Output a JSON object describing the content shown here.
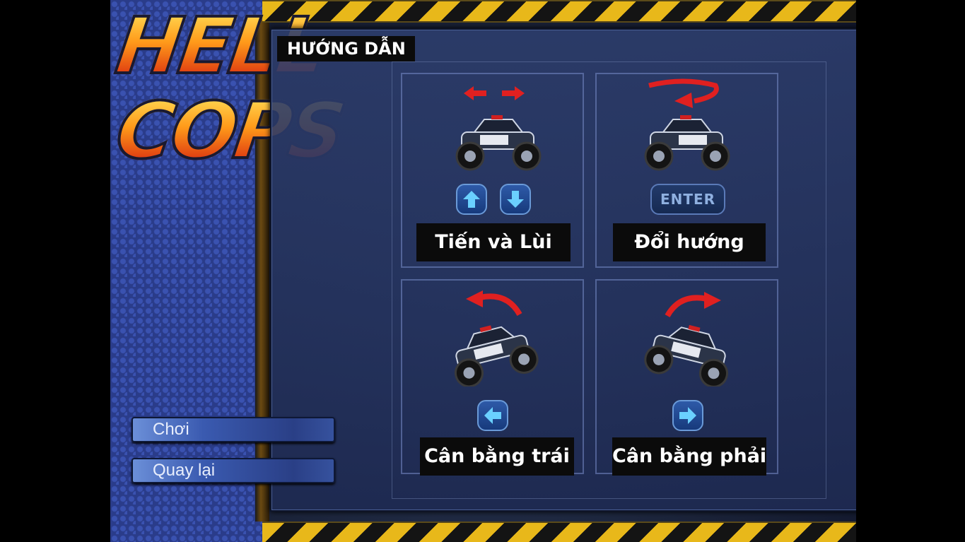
{
  "logo": {
    "line1": "HELL",
    "line2": "COPS"
  },
  "panel": {
    "title": "HƯỚNG DẪN",
    "cells": {
      "forward_back": {
        "label": "Tiến và Lùi",
        "keys": [
          "arrow-up-icon",
          "arrow-down-icon"
        ]
      },
      "turn": {
        "label": "Đổi hướng",
        "key_label": "ENTER"
      },
      "balance_left": {
        "label": "Cân bằng trái",
        "keys": [
          "arrow-left-icon"
        ]
      },
      "balance_right": {
        "label": "Cân bằng phải",
        "keys": [
          "arrow-right-icon"
        ]
      }
    }
  },
  "menu": {
    "play_label": "Chơi",
    "back_label": "Quay lại"
  },
  "colors": {
    "hazard_yellow": "#e8b81a",
    "key_blue": "#2e5aa8",
    "indicator_red": "#e02020",
    "sidebar_blue": "#2a3c8a"
  }
}
